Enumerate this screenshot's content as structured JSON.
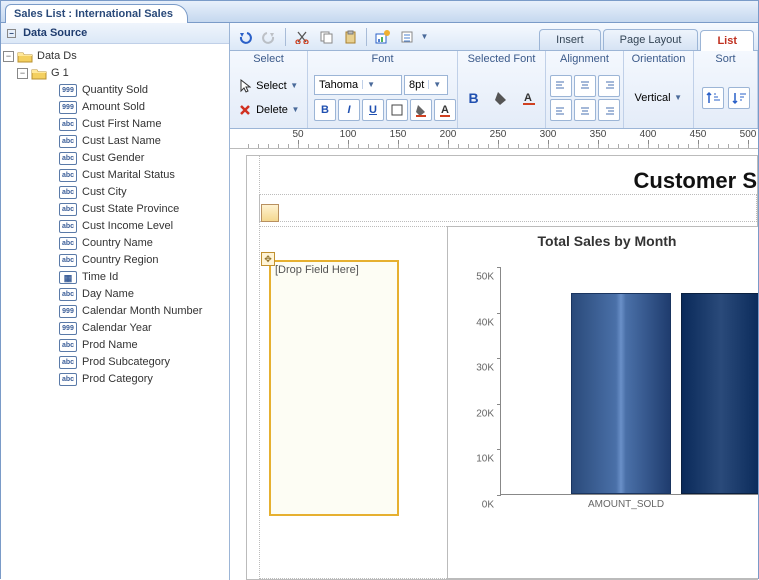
{
  "window_title": "Sales List : International Sales",
  "sidebar": {
    "header": "Data Source",
    "root": "Data Ds",
    "group": "G 1",
    "fields": [
      {
        "type": "999",
        "label": "Quantity Sold"
      },
      {
        "type": "999",
        "label": "Amount Sold"
      },
      {
        "type": "abc",
        "label": "Cust First Name"
      },
      {
        "type": "abc",
        "label": "Cust Last Name"
      },
      {
        "type": "abc",
        "label": "Cust Gender"
      },
      {
        "type": "abc",
        "label": "Cust Marital Status"
      },
      {
        "type": "abc",
        "label": "Cust City"
      },
      {
        "type": "abc",
        "label": "Cust State Province"
      },
      {
        "type": "abc",
        "label": "Cust Income Level"
      },
      {
        "type": "abc",
        "label": "Country Name"
      },
      {
        "type": "abc",
        "label": "Country Region"
      },
      {
        "type": "date",
        "label": "Time Id"
      },
      {
        "type": "abc",
        "label": "Day Name"
      },
      {
        "type": "999",
        "label": "Calendar Month Number"
      },
      {
        "type": "999",
        "label": "Calendar Year"
      },
      {
        "type": "abc",
        "label": "Prod Name"
      },
      {
        "type": "abc",
        "label": "Prod Subcategory"
      },
      {
        "type": "abc",
        "label": "Prod Category"
      }
    ]
  },
  "apptabs": {
    "insert": "Insert",
    "page_layout": "Page Layout",
    "list": "List"
  },
  "ribbon": {
    "groups": {
      "select": "Select",
      "font": "Font",
      "selected_font": "Selected Font",
      "alignment": "Alignment",
      "orientation": "Orientation",
      "sort": "Sort"
    },
    "select_btn": "Select",
    "delete_btn": "Delete",
    "font_name": "Tahoma",
    "font_size": "8pt",
    "vertical": "Vertical"
  },
  "canvas": {
    "report_title": "Customer S",
    "drop_hint": "[Drop Field Here]",
    "chart_title": "Total Sales by Month",
    "x_axis_label": "AMOUNT_SOLD"
  },
  "ruler_ticks": [
    50,
    100,
    150,
    200,
    250,
    300,
    350,
    400,
    450,
    500
  ],
  "chart_data": {
    "type": "bar",
    "title": "Total Sales by Month",
    "categories": [
      "AMOUNT_SOLD"
    ],
    "values": [
      44000
    ],
    "ylim": [
      0,
      50000
    ],
    "yticks": [
      "0K",
      "10K",
      "20K",
      "30K",
      "40K",
      "50K"
    ],
    "xlabel": "",
    "ylabel": ""
  }
}
